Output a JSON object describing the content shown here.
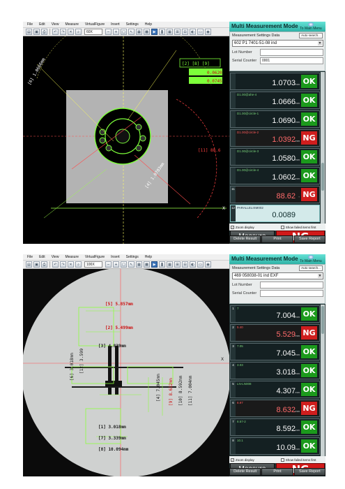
{
  "top": {
    "menu": [
      "File",
      "Edit",
      "View",
      "Measure",
      "VirtualFigure",
      "Insert",
      "Settings",
      "Help"
    ],
    "zoom": "60X",
    "panel": {
      "mode_title": "Multi Measurement Mode",
      "main_menu": "To Main Menu",
      "settings_label": "Measurement Settings Data",
      "auto_search": "Auto search...",
      "settings_value": "602 P1 7401-51-08 ind",
      "lot_label": "Lot Number",
      "lot_value": "",
      "serial_label": "Serial Counter",
      "serial_value": "0001",
      "results": [
        {
          "index": "",
          "name": "",
          "value": "1.0703",
          "unit": "mm",
          "status": "OK"
        },
        {
          "index": "",
          "name": "D1.00@ahe-4",
          "value": "1.0666",
          "unit": "mm",
          "status": "OK"
        },
        {
          "index": "",
          "name": "D1.00@circle-1",
          "value": "1.0690",
          "unit": "mm",
          "status": "OK"
        },
        {
          "index": "",
          "name": "D1.00@circle-2",
          "value": "1.0392",
          "unit": "mm",
          "status": "NG"
        },
        {
          "index": "",
          "name": "D1.00@circle-3",
          "value": "1.0580",
          "unit": "mm",
          "status": "OK"
        },
        {
          "index": "",
          "name": "D1.00@circle-4",
          "value": "1.0602",
          "unit": "mm",
          "status": "OK"
        },
        {
          "index": "11",
          "name": "",
          "value": "88.62",
          "unit": "°",
          "status": "NG"
        },
        {
          "index": "12",
          "name": "PARALLELISM002",
          "value": "0.0089",
          "unit": "",
          "status": ""
        }
      ],
      "zoom_display": "Zoom display",
      "show_failed": "Show failed items first",
      "measure": "Measure",
      "verdict": "NG",
      "delete": "Delete Result",
      "print": "Print",
      "save": "Save Report"
    },
    "overlay_labels": {
      "a": "[2]  [8]  [9]",
      "b": "0.0620",
      "c": "0.0745",
      "d": "[11] 88.6",
      "e": "[6] 1.0666mm",
      "f": "[4] 1.0703mm"
    }
  },
  "bottom": {
    "menu": [
      "File",
      "Edit",
      "View",
      "Measure",
      "VirtualFigure",
      "Insert",
      "Settings",
      "Help"
    ],
    "zoom": "100X",
    "panel": {
      "mode_title": "Multi Measurement Mode",
      "main_menu": "To Main Menu",
      "settings_label": "Measurement Settings Data",
      "auto_search": "Auto search...",
      "settings_value": "469 058038-01 ind EXF",
      "lot_label": "Lot Number",
      "lot_value": "",
      "serial_label": "Serial Counter",
      "serial_value": "",
      "results": [
        {
          "index": "1",
          "name": "7",
          "value": "7.004",
          "unit": "mm",
          "status": "OK"
        },
        {
          "index": "2",
          "name": "5.40",
          "value": "5.529",
          "unit": "mm",
          "status": "NG"
        },
        {
          "index": "3",
          "name": "7.05",
          "value": "7.045",
          "unit": "mm",
          "status": "OK"
        },
        {
          "index": "4",
          "name": "3.03",
          "value": "3.018",
          "unit": "mm",
          "status": "OK"
        },
        {
          "index": "5",
          "name": "LN-LN008",
          "value": "4.307",
          "unit": "mm",
          "status": "OK"
        },
        {
          "index": "6",
          "name": "8.97",
          "value": "8.632",
          "unit": "mm",
          "status": "NG"
        },
        {
          "index": "7",
          "name": "8.57-2",
          "value": "8.592",
          "unit": "mm",
          "status": "OK"
        },
        {
          "index": "8",
          "name": "10.1",
          "value": "10.09",
          "unit": "mm",
          "status": "OK"
        }
      ],
      "zoom_display": "Zoom display",
      "show_failed": "Show failed items first",
      "measure": "Measure",
      "verdict": "NG",
      "delete": "Delete Result",
      "print": "Print",
      "save": "Save Report"
    },
    "overlay_labels": {
      "m1": "[5] 5.857mm",
      "m2": "[2] 5.499mm",
      "m3": "[3] 4.839mm",
      "m4": "[1] 3.018mm",
      "m5": "[6] 3.018mm",
      "m6": "[7] 3.339mm",
      "m7": "[8] 10.094mm",
      "m8": "[4] 7.045mm",
      "m9": "[9] 8.632mm",
      "m10": "[10] 8.592mm",
      "m11": "[11] 7.004mm",
      "m12": "[12] 3.599"
    }
  },
  "colors": {
    "ok_green": "#1c9a1c",
    "ng_red": "#d01a1a",
    "panel_teal": "#3bc3b6",
    "overlay_green": "#8cff3c",
    "overlay_red": "#ff3a3a"
  }
}
